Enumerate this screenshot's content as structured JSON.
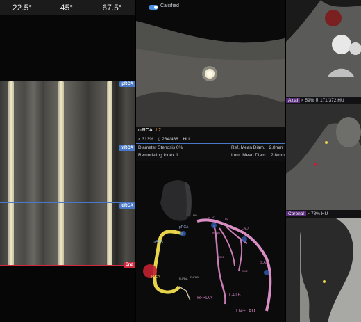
{
  "columns": [
    {
      "angle": "22.5°"
    },
    {
      "angle": "45°"
    },
    {
      "angle": "67.5°"
    }
  ],
  "markers": {
    "prca": "pRCA",
    "mrca": "mRCA",
    "drca": "dRCA",
    "end": "End"
  },
  "calcified": {
    "label": "Calcified",
    "enabled": true
  },
  "info": {
    "segment": "mRCA",
    "segment_tag": "L2",
    "zoom": "313%",
    "slice": "234/468",
    "hu": "HU",
    "diameter_stenosis_label": "Diameter Stenosis",
    "diameter_stenosis_value": "0%",
    "ref_mean_label": "Ref. Mean Diam.",
    "ref_mean_value": "2.8mm",
    "remodeling_label": "Remodeling Index",
    "remodeling_value": "1",
    "lum_mean_label": "Lum. Mean Diam.",
    "lum_mean_value": "2.8mm"
  },
  "tree_labels": {
    "prca": "pRCA",
    "mrca": "mRCA",
    "rca": "RCA",
    "rpda_small": "R-PDA",
    "rplb_small": "R-PLB",
    "rpda": "R-PDA",
    "lm": "LM",
    "lad": "LAD",
    "d1": "D1",
    "d2": "D2",
    "om1": "OM1",
    "om2": "OM2",
    "lplb": "L-PLB",
    "lmlad": "LM+LAD",
    "dlad": "dLAD",
    "plad": "pLAD",
    "mlad": "mLAD"
  },
  "axial": {
    "label": "Axial",
    "zoom": "59%",
    "slice": "171/372",
    "hu": "HU"
  },
  "coronal": {
    "label": "Coronal",
    "zoom": "78%",
    "hu": "HU"
  },
  "colors": {
    "accent_blue": "#4a90e2",
    "rca_yellow": "#e8d44a",
    "lm_pink": "#d98fc4",
    "end_red": "#d0283c",
    "purple": "#5a2d7a"
  }
}
